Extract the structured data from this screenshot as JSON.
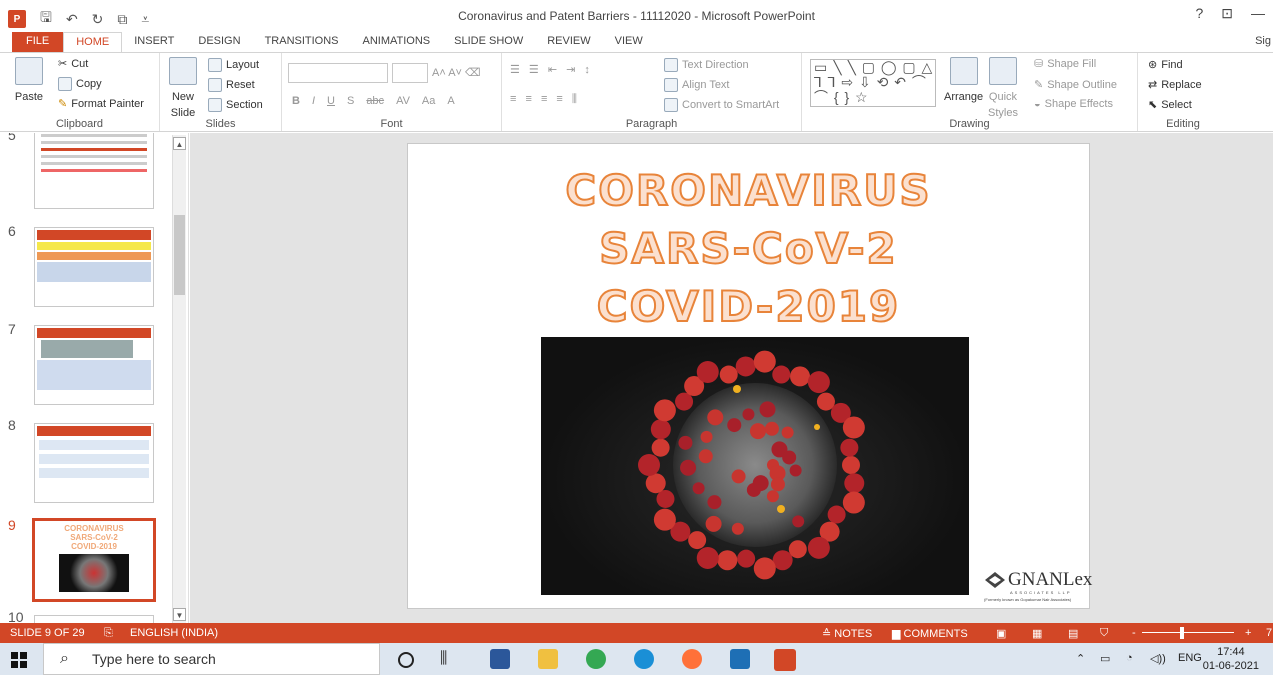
{
  "window": {
    "title": "Coronavirus and Patent Barriers - 11112020 - Microsoft PowerPoint",
    "app_icon": "P",
    "controls": [
      "?",
      "⊡",
      "—"
    ],
    "qat_icons": [
      "save-icon",
      "undo-icon",
      "redo-icon",
      "start-presentation-icon",
      "customize-qat-icon"
    ]
  },
  "tabs": [
    "FILE",
    "HOME",
    "INSERT",
    "DESIGN",
    "TRANSITIONS",
    "ANIMATIONS",
    "SLIDE SHOW",
    "REVIEW",
    "VIEW"
  ],
  "active_tab": "HOME",
  "sign_in": "Sig",
  "ribbon": {
    "clipboard": {
      "label": "Clipboard",
      "paste": "Paste",
      "cut": "Cut",
      "copy": "Copy",
      "format_painter": "Format Painter"
    },
    "slides": {
      "label": "Slides",
      "new_slide_1": "New",
      "new_slide_2": "Slide",
      "layout": "Layout",
      "reset": "Reset",
      "section": "Section"
    },
    "font": {
      "label": "Font",
      "bold": "B",
      "italic": "I",
      "underline": "U",
      "shadow": "S",
      "strike": "abc",
      "spacing": "AV",
      "case": "Aa",
      "color": "A"
    },
    "paragraph": {
      "label": "Paragraph",
      "text_direction": "Text Direction",
      "align_text": "Align Text",
      "convert_smartart": "Convert to SmartArt"
    },
    "drawing": {
      "label": "Drawing",
      "shapes_glyphs": "▭ ╲ ╲ ▢ ◯ ▢ △ ⅂ ⅂ ⇨ ⇩ ⟲ ↶ ⌒ ⌒ { } ☆",
      "arrange": "Arrange",
      "quick_styles_1": "Quick",
      "quick_styles_2": "Styles",
      "shape_fill": "Shape Fill",
      "shape_outline": "Shape Outline",
      "shape_effects": "Shape Effects"
    },
    "editing": {
      "label": "Editing",
      "find": "Find",
      "replace": "Replace",
      "select": "Select"
    }
  },
  "thumbnails": [
    {
      "num": "5",
      "selected": false
    },
    {
      "num": "6",
      "selected": false
    },
    {
      "num": "7",
      "selected": false
    },
    {
      "num": "8",
      "selected": false
    },
    {
      "num": "9",
      "selected": true
    },
    {
      "num": "10",
      "selected": false
    }
  ],
  "thumb9_lines": [
    "CORONAVIRUS",
    "SARS-CoV-2",
    "COVID-2019"
  ],
  "slide": {
    "line1": "CORONAVIRUS",
    "line2": "SARS-CoV-2",
    "line3": "COVID-2019",
    "logo_text": "GNANLex",
    "logo_sub": "ASSOCIATES LLP",
    "logo_caption": "(Formerly known as Gopakumar Nair Associates)"
  },
  "status": {
    "slide_count": "SLIDE 9 OF 29",
    "language": "ENGLISH (INDIA)",
    "notes": "NOTES",
    "comments": "COMMENTS",
    "zoom_plus": "+",
    "zoom_minus": "-",
    "zoom_value": "7"
  },
  "taskbar": {
    "search_placeholder": "Type here to search",
    "lang": "ENG",
    "time": "17:44",
    "date": "01-06-2021"
  },
  "colors": {
    "accent": "#d24726",
    "title_fill": "#fbe0cf",
    "title_stroke": "#e8843a"
  }
}
